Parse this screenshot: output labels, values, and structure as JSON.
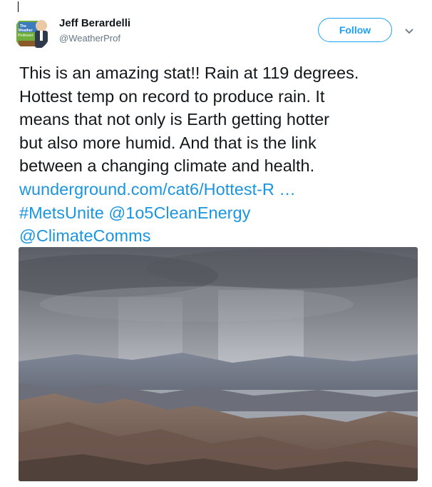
{
  "author": {
    "name": "Jeff Berardelli",
    "handle": "@WeatherProf",
    "avatar_logo_text": "The Weather Professor"
  },
  "follow_button": {
    "label": "Follow"
  },
  "tweet": {
    "lines": [
      "This is an amazing stat!! Rain at 119 degrees.",
      "Hottest temp on record to produce rain. It",
      "means that not only is Earth getting hotter",
      "but also more humid. And that is the link",
      "between a changing climate and health."
    ],
    "link_url_text": "wunderground.com/cat6/Hottest-R …",
    "hashtag": "#MetsUnite",
    "mention_1": "@1o5CleanEnergy",
    "mention_2": "@ClimateComms"
  },
  "icons": {
    "menu": "chevron-down-icon"
  },
  "colors": {
    "accent": "#1da1f2",
    "link": "#1b95e0",
    "text": "#14171a",
    "muted": "#657786"
  }
}
